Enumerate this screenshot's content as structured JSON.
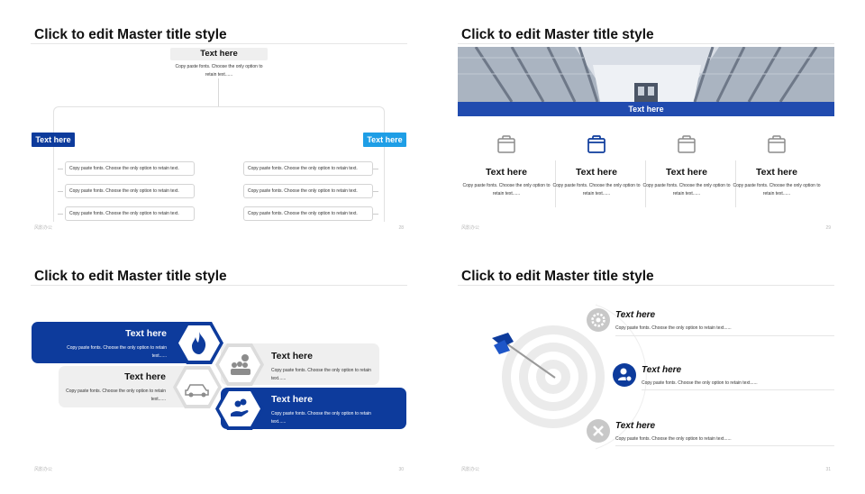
{
  "title": "Click to edit Master title style",
  "footer_left": "风影办公",
  "slide1": {
    "page": "28",
    "top_title": "Text here",
    "top_desc": "Copy paste fonts. Choose the only option to retain text......",
    "left_tag": "Text here",
    "right_tag": "Text here",
    "left_items": [
      "Copy paste fonts. Choose the only option to retain text.",
      "Copy paste fonts. Choose the only option to retain text.",
      "Copy paste fonts. Choose the only option to retain text."
    ],
    "right_items": [
      "Copy paste fonts. Choose the only option to retain text.",
      "Copy paste fonts. Choose the only option to retain text.",
      "Copy paste fonts. Choose the only option to retain text."
    ],
    "colors": {
      "dark_blue": "#0d3b9c",
      "light_blue": "#1e9ee6"
    }
  },
  "slide2": {
    "page": "29",
    "banner": "Text here",
    "columns": [
      {
        "title": "Text here",
        "desc": "Copy paste fonts. Choose the only option to retain text......",
        "icon": "shopping-bag-icon"
      },
      {
        "title": "Text here",
        "desc": "Copy paste fonts. Choose the only option to retain text......",
        "icon": "shopping-bag-icon"
      },
      {
        "title": "Text here",
        "desc": "Copy paste fonts. Choose the only option to retain text......",
        "icon": "shopping-bag-icon"
      },
      {
        "title": "Text here",
        "desc": "Copy paste fonts. Choose the only option to retain text......",
        "icon": "shopping-bag-icon"
      }
    ]
  },
  "slide3": {
    "page": "30",
    "blocks": [
      {
        "title": "Text here",
        "desc": "Copy paste fonts. Choose the only option to retain text......",
        "icon": "fire-icon"
      },
      {
        "title": "Text here",
        "desc": "Copy paste fonts. Choose the only option to retain text......",
        "icon": "team-dollar-icon"
      },
      {
        "title": "Text here",
        "desc": "Copy paste fonts. Choose the only option to retain text......",
        "icon": "car-icon"
      },
      {
        "title": "Text here",
        "desc": "Copy paste fonts. Choose the only option to retain text......",
        "icon": "hand-coins-icon"
      }
    ]
  },
  "slide4": {
    "page": "31",
    "items": [
      {
        "title": "Text here",
        "desc": "Copy paste fonts. Choose the only option to retain text......",
        "icon": "gear-icon"
      },
      {
        "title": "Text here",
        "desc": "Copy paste fonts. Choose the only option to retain text......",
        "icon": "user-settings-icon"
      },
      {
        "title": "Text here",
        "desc": "Copy paste fonts. Choose the only option to retain text......",
        "icon": "tools-icon"
      }
    ]
  }
}
